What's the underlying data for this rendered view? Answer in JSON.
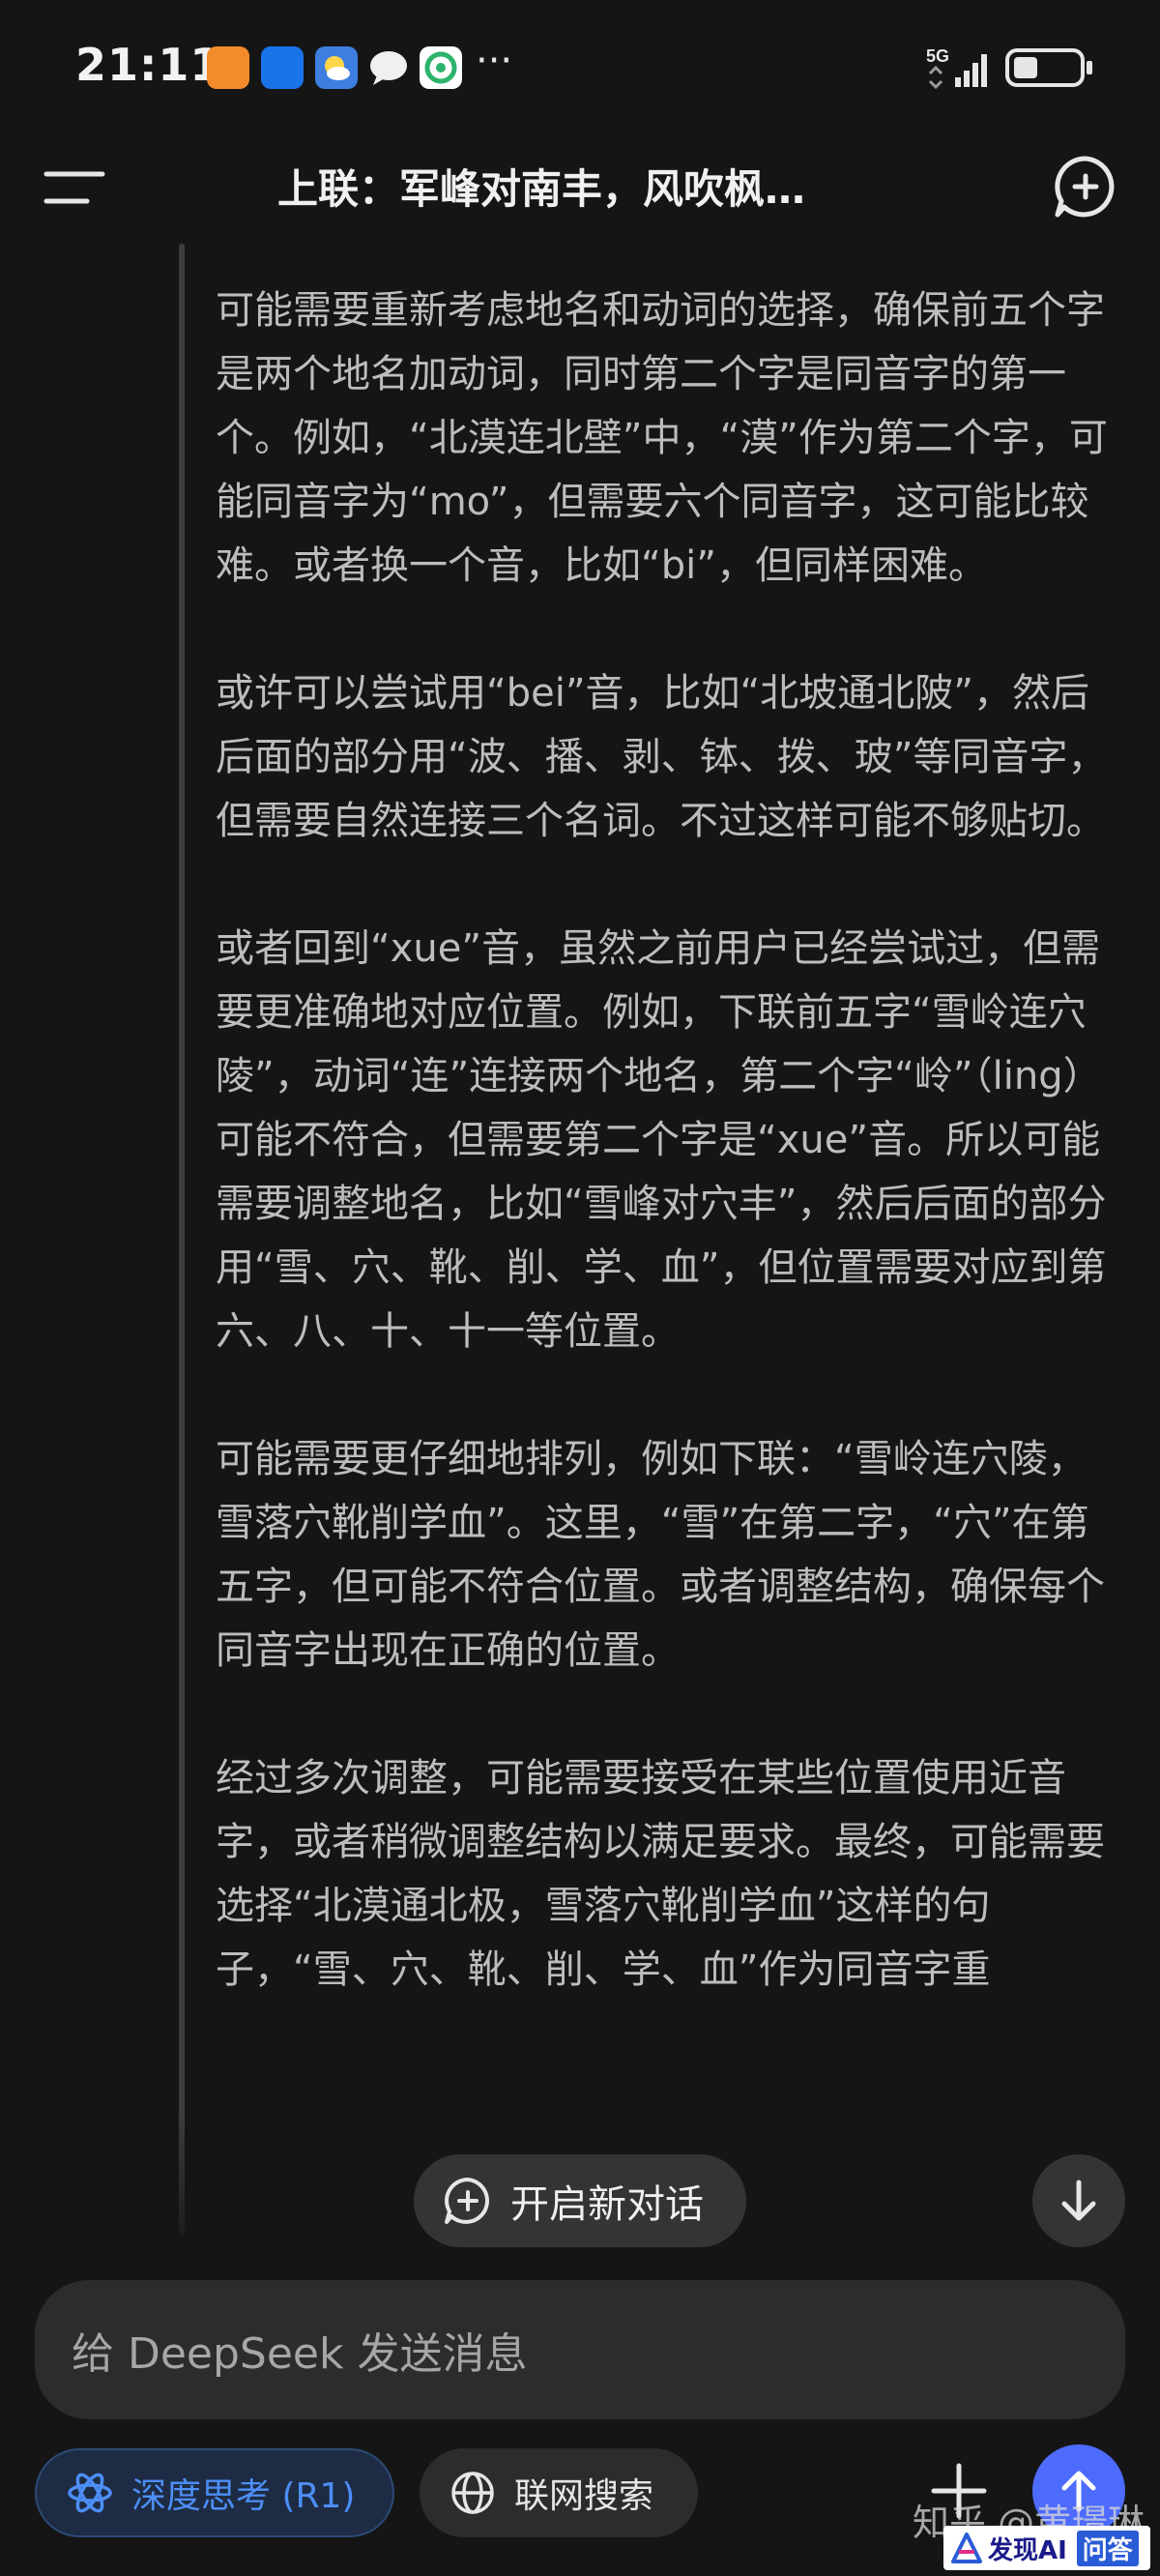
{
  "status_bar": {
    "time": "21:11",
    "more": "···",
    "network": "5G"
  },
  "header": {
    "title": "上联：军峰对南丰，风吹枫…"
  },
  "thinking": {
    "paragraphs": [
      "可能需要重新考虑地名和动词的选择，确保前五个字是两个地名加动词，同时第二个字是同音字的第一个。例如，“北漠连北壁”中，“漠”作为第二个字，可能同音字为“mo”，但需要六个同音字，这可能比较难。或者换一个音，比如“bi”，但同样困难。",
      "或许可以尝试用“bei”音，比如“北坡通北陂”，然后后面的部分用“波、播、剥、钵、拨、玻”等同音字，但需要自然连接三个名词。不过这样可能不够贴切。",
      "或者回到“xue”音，虽然之前用户已经尝试过，但需要更准确地对应位置。例如，下联前五字“雪岭连穴陵”，动词“连”连接两个地名，第二个字“岭”（ling）可能不符合，但需要第二个字是“xue”音。所以可能需要调整地名，比如“雪峰对穴丰”，然后后面的部分用“雪、穴、靴、削、学、血”，但位置需要对应到第六、八、十、十一等位置。",
      "可能需要更仔细地排列，例如下联：“雪岭连穴陵，雪落穴靴削学血”。这里，“雪”在第二字，“穴”在第五字，但可能不符合位置。或者调整结构，确保每个同音字出现在正确的位置。",
      "经过多次调整，可能需要接受在某些位置使用近音字，或者稍微调整结构以满足要求。最终，可能需要选择“北漠通北极，雪落穴靴削学血”这样的句子，“雪、穴、靴、削、学、血”作为同音字重"
    ]
  },
  "floating": {
    "new_chat_label": "开启新对话"
  },
  "input": {
    "placeholder": "给 DeepSeek 发送消息"
  },
  "chips": {
    "deep_think": "深度思考 (R1)",
    "web_search": "联网搜索"
  },
  "watermark": {
    "text": "知乎 @黄璟琳",
    "logo_text_1": "发现AI",
    "logo_text_2": "问答"
  },
  "colors": {
    "background": "#151515",
    "accent_blue": "#4d6bfe",
    "deep_think_text": "#4d8ef7"
  }
}
